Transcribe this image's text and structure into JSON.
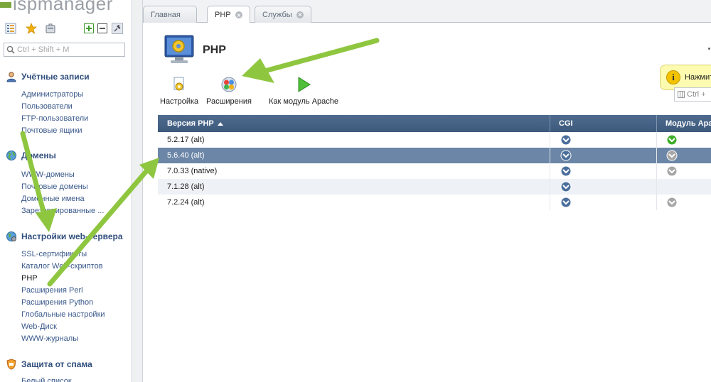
{
  "app": {
    "logo_text": "ispmanager"
  },
  "sidebar": {
    "search_placeholder": "Ctrl + Shift + M",
    "groups": [
      {
        "title": "Учётные записи",
        "icon": "user-icon",
        "items": [
          "Администраторы",
          "Пользователи",
          "FTP-пользователи",
          "Почтовые ящики"
        ]
      },
      {
        "title": "Домены",
        "icon": "globe-icon",
        "items": [
          "WWW-домены",
          "Почтовые домены",
          "Доменные имена",
          "Зарезервированные ..."
        ]
      },
      {
        "title": "Настройки web-сервера",
        "icon": "globe-gear-icon",
        "items": [
          "SSL-сертификаты",
          "Каталог Web-скриптов",
          "PHP",
          "Расширения Perl",
          "Расширения Python",
          "Глобальные настройки",
          "Web-Диск",
          "WWW-журналы"
        ]
      },
      {
        "title": "Защита от спама",
        "icon": "shield-icon",
        "items": [
          "Белый список"
        ]
      }
    ],
    "active_item": "PHP"
  },
  "tabs": [
    {
      "label": "Главная",
      "closable": false,
      "active": false
    },
    {
      "label": "PHP",
      "closable": true,
      "active": true
    },
    {
      "label": "Службы",
      "closable": true,
      "active": false
    }
  ],
  "page": {
    "title": "PHP",
    "hint_text": "Нажмит",
    "filter_text": "Ctrl +",
    "actions": [
      {
        "label": "Настройка",
        "icon": "settings-icon"
      },
      {
        "label": "Расширения",
        "icon": "extensions-icon"
      },
      {
        "label": "Как модуль Apache",
        "icon": "play-icon"
      }
    ]
  },
  "table": {
    "columns": [
      "Версия PHP",
      "CGI",
      "Модуль Apache"
    ],
    "sorted_column": "Версия PHP",
    "sort_direction": "asc",
    "rows": [
      {
        "version": "5.2.17 (alt)",
        "cgi": "on",
        "apache": "active",
        "selected": false
      },
      {
        "version": "5.6.40 (alt)",
        "cgi": "on",
        "apache": "on",
        "selected": true
      },
      {
        "version": "7.0.33 (native)",
        "cgi": "on",
        "apache": "on",
        "selected": false
      },
      {
        "version": "7.1.28 (alt)",
        "cgi": "on",
        "apache": "none",
        "selected": false
      },
      {
        "version": "7.2.24 (alt)",
        "cgi": "on",
        "apache": "on",
        "selected": false
      }
    ]
  },
  "colors": {
    "header_bg": "#476487",
    "selected_row": "#6b86a6",
    "nav_link": "#39588a",
    "annotation_arrow": "#8fc640",
    "status_blue": "#4a6f9c",
    "status_green": "#3fae29",
    "status_gray": "#a6a6a6"
  }
}
